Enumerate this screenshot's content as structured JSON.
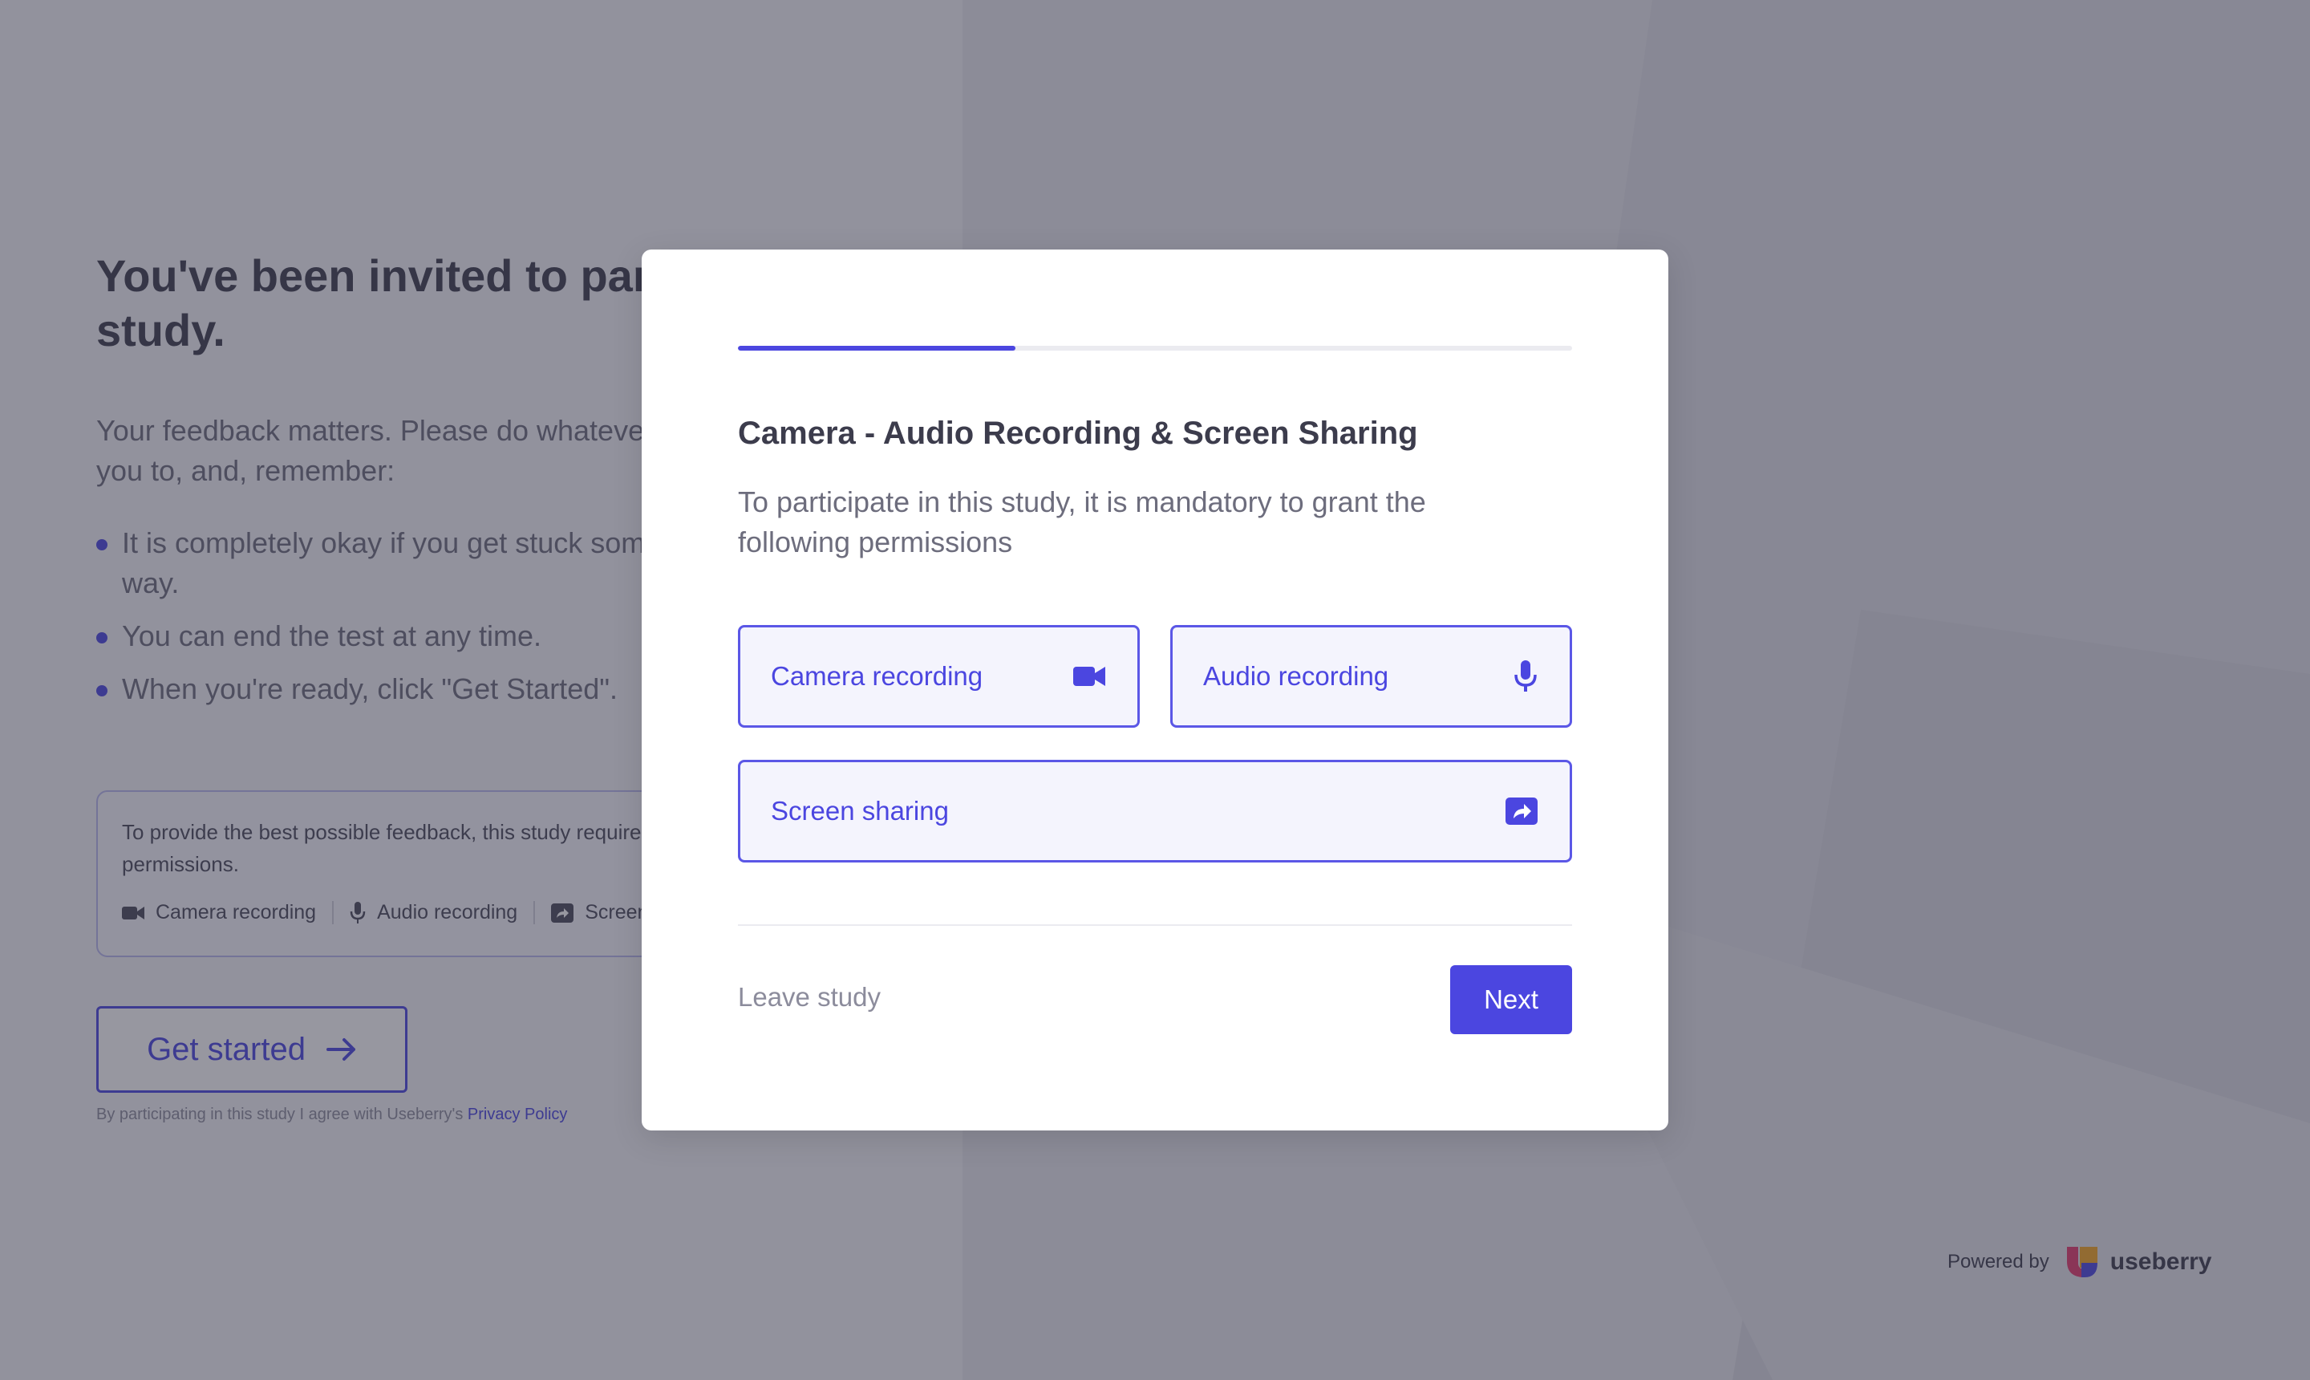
{
  "landing": {
    "title": "You've been invited to participate in a study.",
    "intro": "Your feedback matters. Please do whatever your intuition tells you to, and, remember:",
    "bullets": [
      "It is completely okay if you get stuck somewhere along the way.",
      "You can end the test at any time.",
      "When you're ready, click \"Get Started\"."
    ],
    "permissions_note": "To provide the best possible feedback, this study requires the following permissions.",
    "permission_chips": [
      "Camera recording",
      "Audio recording",
      "Screen sharing"
    ],
    "get_started_label": "Get started",
    "terms_text": "By participating in this study I agree with Useberry's",
    "privacy_link": "Privacy Policy"
  },
  "modal": {
    "progress": 0.333,
    "title": "Camera - Audio Recording & Screen Sharing",
    "description": "To participate in this study, it is mandatory to grant the following permissions",
    "permissions": [
      {
        "label": "Camera recording",
        "icon": "video-camera-icon"
      },
      {
        "label": "Audio recording",
        "icon": "microphone-icon"
      },
      {
        "label": "Screen sharing",
        "icon": "share-screen-icon"
      }
    ],
    "leave_label": "Leave study",
    "next_label": "Next"
  },
  "footer": {
    "powered_by": "Powered by",
    "brand": "useberry"
  },
  "colors": {
    "accent": "#4b46e0",
    "title": "#3c3c4c",
    "muted": "#6d6d7d"
  }
}
